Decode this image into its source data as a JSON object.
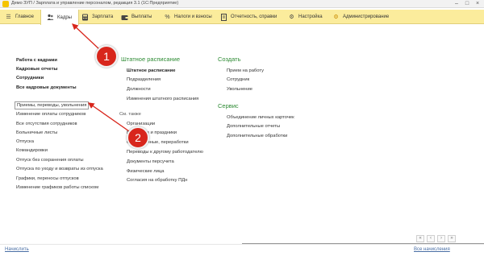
{
  "window": {
    "title": "Демо ЗУП / Зарплата и управление персоналом, редакция 3.1  (1С:Предприятие)",
    "controls": [
      "–",
      "□",
      "×"
    ]
  },
  "sections": [
    {
      "label": "Главное",
      "icon": "menu-icon"
    },
    {
      "label": "Кадры",
      "icon": "people-icon",
      "active": true
    },
    {
      "label": "Зарплата",
      "icon": "calculator-icon"
    },
    {
      "label": "Выплаты",
      "icon": "wallet-icon"
    },
    {
      "label": "Налоги и взносы",
      "icon": "percent-icon"
    },
    {
      "label": "Отчетность, справки",
      "icon": "report-icon"
    },
    {
      "label": "Настройка",
      "icon": "gear-icon"
    },
    {
      "label": "Администрирование",
      "icon": "admin-gear-icon"
    }
  ],
  "left_column": {
    "bold_links": [
      "Работа с кадрами",
      "Кадровые отчеты",
      "Сотрудники",
      "Все кадровые документы"
    ],
    "links": [
      "Приемы, переводы, увольнения",
      "Изменение оплаты сотрудников",
      "Все отсутствия сотрудников",
      "Больничные листы",
      "Отпуска",
      "Командировки",
      "Отпуск без сохранения оплаты",
      "Отпуска по уходу и возвраты из отпуска",
      "Графики, переносы отпусков",
      "Изменение графиков работы списком"
    ]
  },
  "middle_column": {
    "group_title": "Штатное расписание",
    "bold_link": "Штатное расписание",
    "links": [
      "Подразделения",
      "Должности",
      "Изменения штатного расписания"
    ],
    "see_also_label": "См. также",
    "see_also_links": [
      "Организации",
      "Выходные и праздники",
      "Сверхурочные, переработки",
      "Переводы к другому работодателю",
      "Документы персучета",
      "Физические лица",
      "Согласия на обработку ПДн"
    ]
  },
  "right_column": {
    "create_title": "Создать",
    "create_links": [
      "Прием на работу",
      "Сотрудник",
      "Увольнение"
    ],
    "service_title": "Сервис",
    "service_links": [
      "Объединение личных карточек",
      "Дополнительные отчеты",
      "Дополнительные обработки"
    ]
  },
  "callouts": [
    "1",
    "2"
  ],
  "bottom": {
    "left_link": "Начислить",
    "right_link": "Все начисления"
  },
  "colors": {
    "section_bar": "#fbec9c",
    "group_title": "#2e8b34",
    "callout": "#d8261c",
    "bottom_link": "#4a6fa5"
  }
}
